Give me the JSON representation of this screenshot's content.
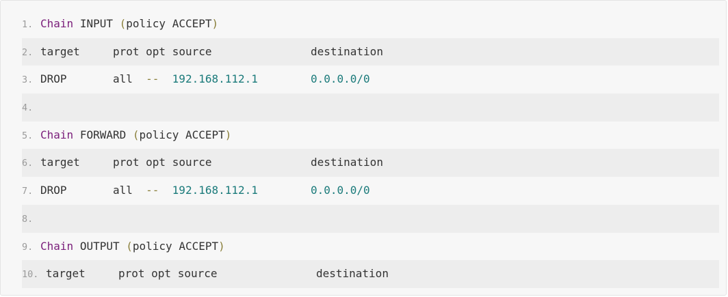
{
  "code_lines": [
    {
      "n": "1.",
      "keyword": "Chain",
      "name": "INPUT",
      "open": "(",
      "policy": "policy ACCEPT",
      "close": ")"
    },
    {
      "n": "2.",
      "target": "target",
      "prot": "prot",
      "opt": "opt",
      "source": "source",
      "destination": "destination"
    },
    {
      "n": "3.",
      "target": "DROP",
      "prot": "all",
      "opt": "--",
      "source": "192.168.112.1",
      "destination": "0.0.0.0/0"
    },
    {
      "n": "4."
    },
    {
      "n": "5.",
      "keyword": "Chain",
      "name": "FORWARD",
      "open": "(",
      "policy": "policy ACCEPT",
      "close": ")"
    },
    {
      "n": "6.",
      "target": "target",
      "prot": "prot",
      "opt": "opt",
      "source": "source",
      "destination": "destination"
    },
    {
      "n": "7.",
      "target": "DROP",
      "prot": "all",
      "opt": "--",
      "source": "192.168.112.1",
      "destination": "0.0.0.0/0"
    },
    {
      "n": "8."
    },
    {
      "n": "9.",
      "keyword": "Chain",
      "name": "OUTPUT",
      "open": "(",
      "policy": "policy ACCEPT",
      "close": ")"
    },
    {
      "n": "10.",
      "target": "target",
      "prot": "prot",
      "opt": "opt",
      "source": "source",
      "destination": "destination"
    }
  ],
  "colors": {
    "keyword": "#7a1e7a",
    "paren": "#8a7f3a",
    "number": "#1a7a7a",
    "line_number": "#9a9a9a",
    "text": "#333333",
    "alt_row": "#ededed",
    "block_bg": "#f7f7f7"
  }
}
